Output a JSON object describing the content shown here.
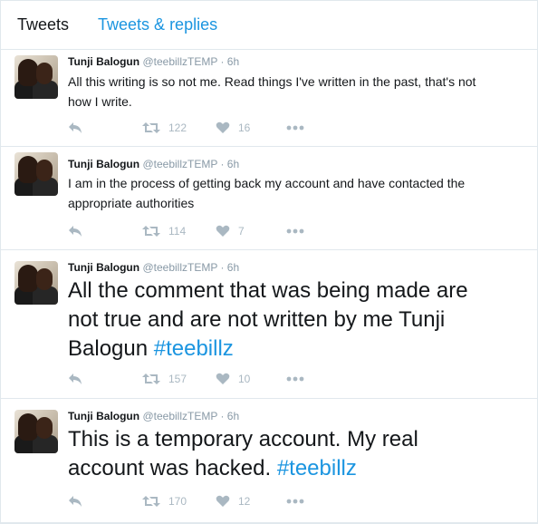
{
  "tabs": [
    {
      "label": "Tweets",
      "active": true
    },
    {
      "label": "Tweets & replies",
      "active": false
    }
  ],
  "colors": {
    "accent": "#1b95e0",
    "muted": "#8899a6",
    "icon": "#aab8c2"
  },
  "tweets": [
    {
      "name": "Tunji Balogun",
      "handle": "@teebillzTEMP",
      "sep": "·",
      "time": "6h",
      "text": "All this writing is so not me. Read things I've written in the past, that's not",
      "text2": "how I write.",
      "hashtag": "",
      "retweets": "122",
      "likes": "16"
    },
    {
      "name": "Tunji Balogun",
      "handle": "@teebillzTEMP",
      "sep": "·",
      "time": "6h",
      "text": "I am in the process of getting back my account and have contacted the",
      "text2": "appropriate authorities",
      "hashtag": "",
      "retweets": "114",
      "likes": "7"
    },
    {
      "name": "Tunji Balogun",
      "handle": "@teebillzTEMP",
      "sep": "·",
      "time": "6h",
      "text": "All the comment that was being made are",
      "text2": "not true and are not written by me Tunji",
      "text3": "Balogun ",
      "hashtag": "#teebillz",
      "retweets": "157",
      "likes": "10"
    },
    {
      "name": "Tunji Balogun",
      "handle": "@teebillzTEMP",
      "sep": "·",
      "time": "6h",
      "text": "This is a temporary account. My real",
      "text2": "account was hacked. ",
      "hashtag": "#teebillz",
      "retweets": "170",
      "likes": "12"
    }
  ],
  "icons": {
    "reply": "reply-icon",
    "retweet": "retweet-icon",
    "like": "heart-icon",
    "more": "more-icon"
  }
}
